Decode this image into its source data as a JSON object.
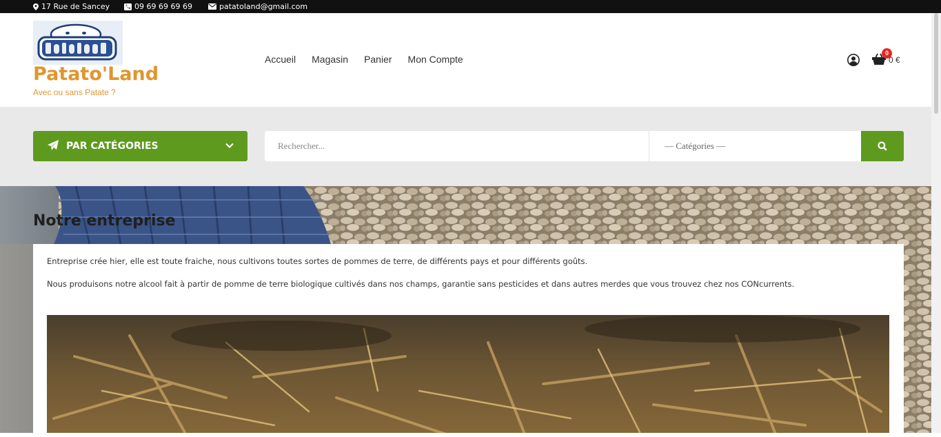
{
  "topbar": {
    "address": "17 Rue de Sancey",
    "phone": "09 69 69 69 69",
    "email": "patatoland@gmail.com"
  },
  "header": {
    "logo_text": "Potatoland",
    "site_title": "Patato'Land",
    "tagline": "Avec ou sans Patate ?",
    "nav": [
      "Accueil",
      "Magasin",
      "Panier",
      "Mon Compte"
    ],
    "cart_count": "0",
    "cart_total": "0 €"
  },
  "search": {
    "categories_button": "PAR CATÉGORIES",
    "placeholder": "Rechercher...",
    "category_select": "— Catégories —"
  },
  "content": {
    "title": "Notre entreprise",
    "paragraph1": "Entreprise crée hier, elle est toute fraiche, nous cultivons toutes sortes de pommes de terre, de différents pays et pour différents goûts.",
    "paragraph2": "Nous produisons notre alcool fait à partir de pomme de terre biologique cultivés dans nos champs, garantie sans pesticides et dans autres merdes que vous trouvez chez nos CONcurrents."
  },
  "colors": {
    "accent_green": "#5e9a1e",
    "title_orange": "#e0962f",
    "badge_red": "#e8261f",
    "topbar_bg": "#111111"
  },
  "icons": {
    "address": "map-marker-icon",
    "phone": "phone-icon",
    "email": "envelope-icon",
    "account": "user-circle-icon",
    "cart": "shopping-basket-icon",
    "categories": "paper-plane-icon",
    "dropdown": "chevron-down-icon",
    "search": "search-icon"
  }
}
